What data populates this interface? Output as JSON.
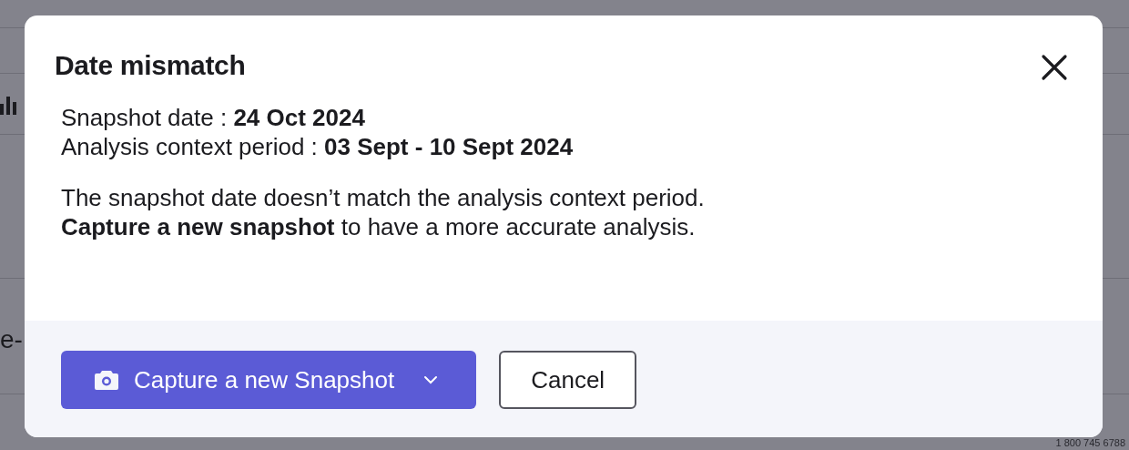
{
  "background": {
    "fragment": "e-",
    "phone": "1 800 745 6788"
  },
  "dialog": {
    "title": "Date mismatch",
    "details": [
      {
        "label": "Snapshot date : ",
        "value": "24 Oct 2024"
      },
      {
        "label": "Analysis context period : ",
        "value": "03 Sept - 10 Sept 2024"
      }
    ],
    "message": [
      "The snapshot date doesn’t match the analysis context period.",
      "**Capture a new snapshot** to have a more accurate analysis."
    ],
    "primary_button": "Capture a new Snapshot",
    "cancel_button": "Cancel"
  }
}
